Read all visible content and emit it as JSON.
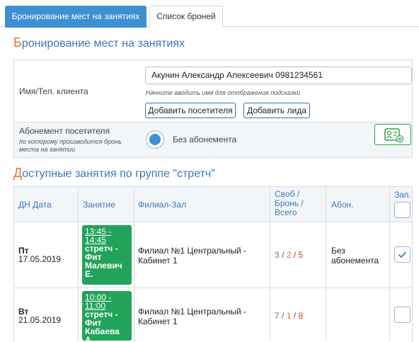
{
  "tabs": {
    "booking": "Бронирование мест на занятиях",
    "list": "Список броней"
  },
  "section1": {
    "title_first": "Б",
    "title_rest": "ронирование мест на занятиях"
  },
  "client": {
    "label": "Имя/Тел. клиента",
    "value": "Акунин Александр Алексеевич 0981234561",
    "hint": "Начните вводить имя для отображения подсказки",
    "add_visitor": "Добавить посетителя",
    "add_lead": "Добавить лида"
  },
  "subscription": {
    "label": "Абонемент посетителя",
    "hint": "по которому производится бронь места на занятии",
    "option": "Без абонемента",
    "card_icon": "id-card-plus-icon"
  },
  "section2": {
    "title_first": "Д",
    "title_rest": "оступные занятия по группе \"стретч\""
  },
  "table": {
    "headers": {
      "date": "ДН Дата",
      "lesson": "Занятие",
      "branch": "Филиал-Зал",
      "free": "Своб / Бронь / Всего",
      "abon": "Абон.",
      "book": "Зап."
    },
    "rows": [
      {
        "day": "Пт",
        "date": "17.05.2019",
        "time": "13:45 - 14:45",
        "lesson_name": "стретч - Фит",
        "trainer": "Малевич Е.",
        "branch": "Филиал №1 Центральный - Кабинет 1",
        "free": "3",
        "booked": "2",
        "total": "5",
        "abon": "Без абонемента",
        "checked": true
      },
      {
        "day": "Вт",
        "date": "21.05.2019",
        "time": "10:00 - 11:00",
        "lesson_name": "стретч - Фит",
        "trainer": "Кабаева А.",
        "branch": "Филиал №1 Центральный - Кабинет 1",
        "free": "7",
        "booked": "1",
        "total": "8",
        "abon": "",
        "checked": false
      }
    ]
  },
  "colors": {
    "accent": "#3f90d2",
    "title": "#3a78b8",
    "title_first_letter": "#e8722a",
    "lesson_bg": "#21a35a"
  }
}
